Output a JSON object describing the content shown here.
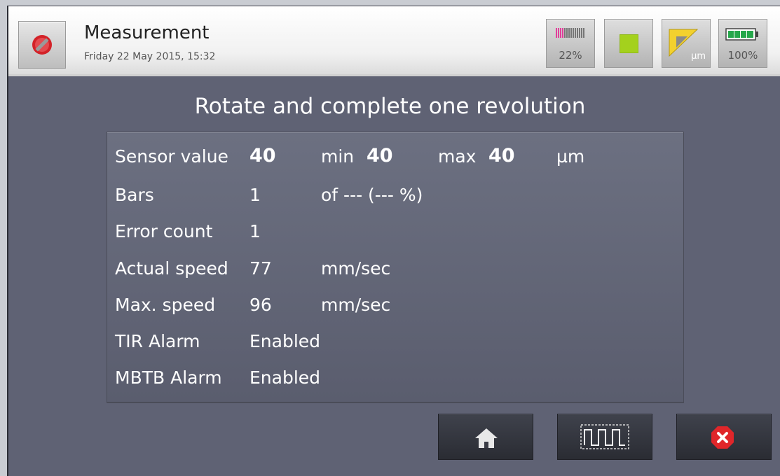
{
  "header": {
    "title": "Measurement",
    "datetime": "Friday 22 May 2015, 15:32",
    "stop_button_icon": "stop-icon"
  },
  "status": {
    "signal_percent": "22%",
    "indicator_color": "#a4d11d",
    "unit": "µm",
    "battery_percent": "100%"
  },
  "main": {
    "title": "Rotate and complete one revolution"
  },
  "readings": {
    "sensor_label": "Sensor value",
    "sensor_value": "40",
    "min_label": "min",
    "min_value": "40",
    "max_label": "max",
    "max_value": "40",
    "unit": "µm",
    "bars_label": "Bars",
    "bars_value": "1",
    "bars_of": "of --- (--- %)",
    "error_label": "Error count",
    "error_value": "1",
    "actual_speed_label": "Actual speed",
    "actual_speed_value": "77",
    "actual_speed_unit": "mm/sec",
    "max_speed_label": "Max. speed",
    "max_speed_value": "96",
    "max_speed_unit": "mm/sec",
    "tir_label": "TIR Alarm",
    "tir_value": "Enabled",
    "mbtb_label": "MBTB Alarm",
    "mbtb_value": "Enabled"
  },
  "footer": {
    "home_icon": "home-icon",
    "waveform_icon": "waveform-icon",
    "close_icon": "close-icon"
  },
  "colors": {
    "background": "#5f6274",
    "panel": "#656979",
    "cancel_red": "#e0262a"
  }
}
